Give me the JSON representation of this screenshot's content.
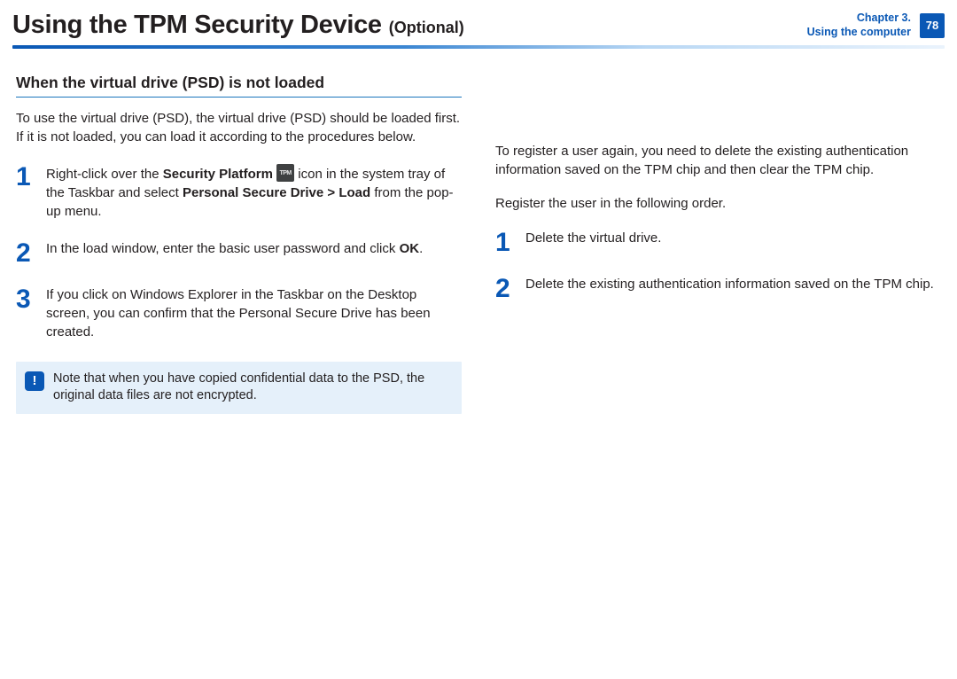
{
  "header": {
    "title": "Using the TPM Security Device",
    "optional": "(Optional)",
    "chapter_line1": "Chapter 3.",
    "chapter_line2": "Using the computer",
    "page_number": "78"
  },
  "left": {
    "section_title": "When the virtual drive (PSD) is not loaded",
    "intro": "To use the virtual drive (PSD), the virtual drive (PSD) should be loaded first. If it is not loaded, you can load it according to the procedures below.",
    "step1_pre": "Right-click over the ",
    "step1_bold1": "Security Platform",
    "step1_mid": " icon in the system tray of the Taskbar and select ",
    "step1_bold2": "Personal Secure Drive > Load",
    "step1_post": " from the pop-up menu.",
    "tpm_icon_label": "TPM",
    "step2_pre": "In the load window, enter the basic user password and click ",
    "step2_bold": "OK",
    "step2_post": ".",
    "step3": "If you click on Windows Explorer in the Taskbar on the Desktop screen, you can confirm that the Personal Secure Drive has been created.",
    "note": "Note that when you have copied confidential data to the PSD, the original data files are not encrypted."
  },
  "right": {
    "intro1": "To register a user again, you need to delete the existing authentication information saved on the TPM chip and then clear the TPM chip.",
    "intro2": "Register the user in the following order.",
    "step1": "Delete the virtual drive.",
    "step2": "Delete the existing authentication information saved on the TPM chip."
  },
  "numbers": {
    "n1": "1",
    "n2": "2",
    "n3": "3"
  },
  "note_mark": "!"
}
